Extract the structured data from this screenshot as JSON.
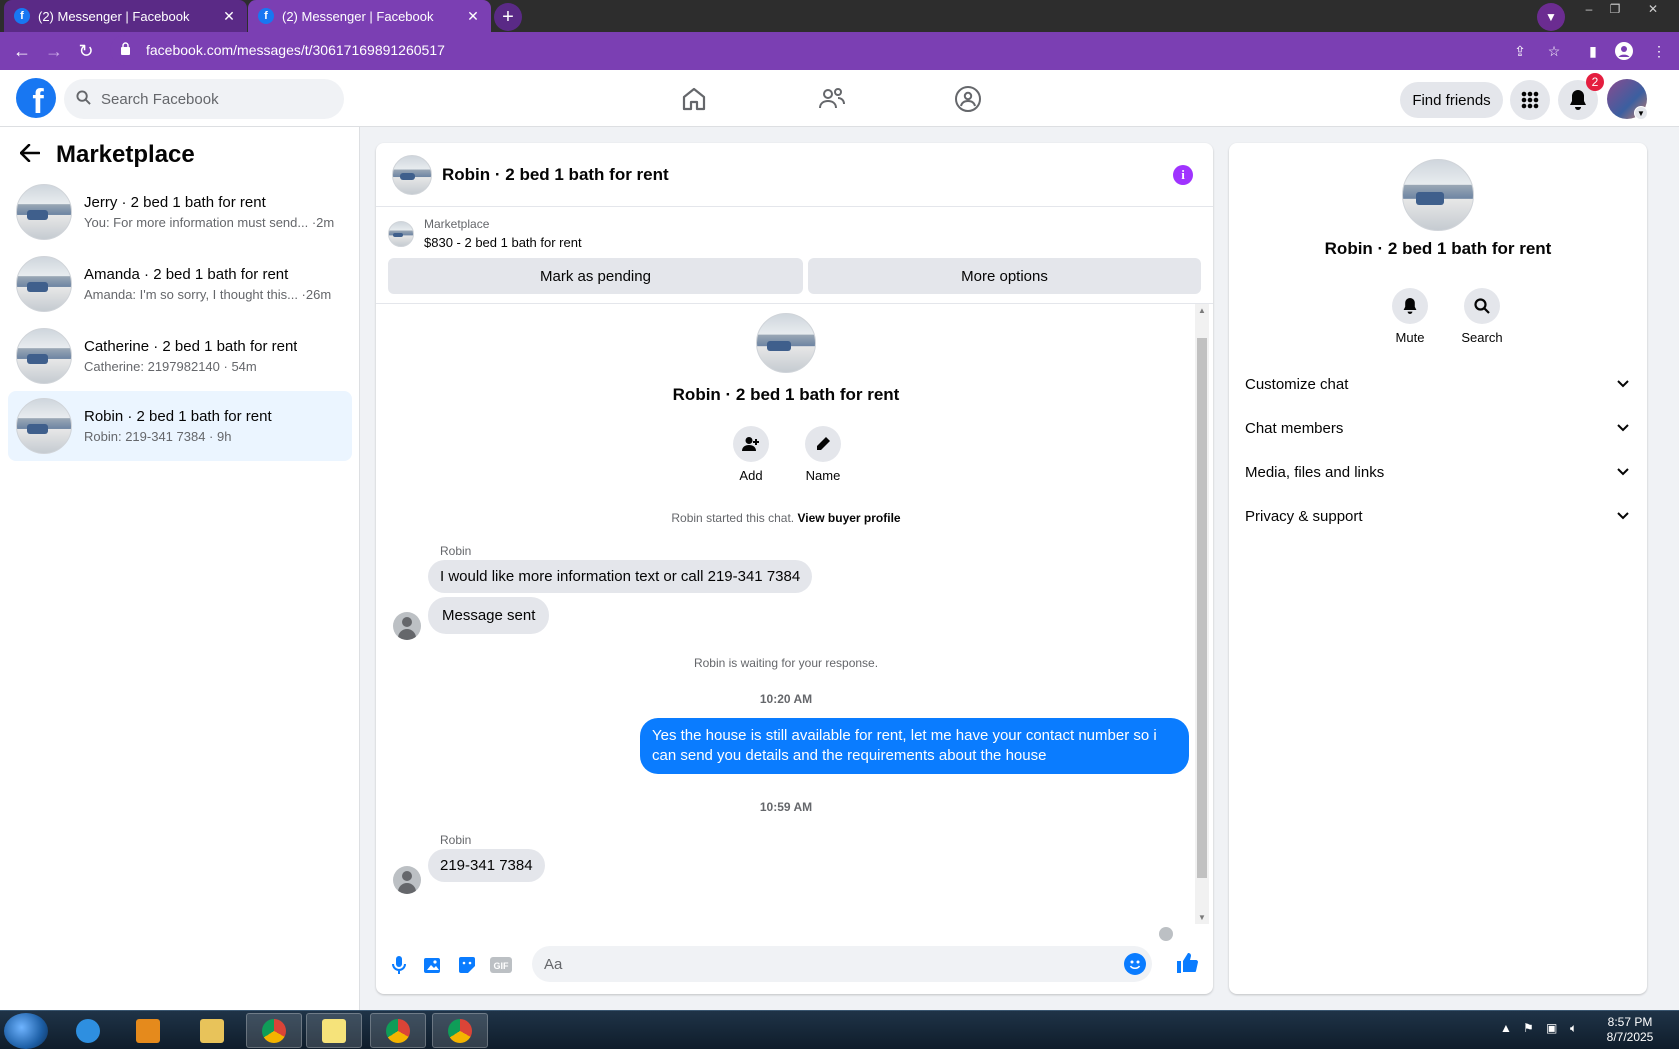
{
  "browser": {
    "tabs": [
      {
        "title": "(2) Messenger | Facebook",
        "active": false
      },
      {
        "title": "(2) Messenger | Facebook",
        "active": true
      }
    ],
    "url": "facebook.com/messages/t/30617169891260517"
  },
  "header": {
    "search_placeholder": "Search Facebook",
    "find_friends_label": "Find friends",
    "notification_count": "2",
    "brand_color": "#1877f2"
  },
  "sidebar": {
    "title": "Marketplace",
    "conversations": [
      {
        "name": "Jerry · 2 bed 1 bath for rent",
        "preview": "You: For more information must send... ·2m",
        "active": false
      },
      {
        "name": "Amanda · 2 bed 1 bath for rent",
        "preview": "Amanda: I'm so sorry, I thought this... ·26m",
        "active": false
      },
      {
        "name": "Catherine · 2 bed 1 bath for rent",
        "preview": "Catherine: 2197982140 · 54m",
        "active": false
      },
      {
        "name": "Robin · 2 bed 1 bath for rent",
        "preview": "Robin: 219-341 7384 · 9h",
        "active": true
      }
    ]
  },
  "chat": {
    "title": "Robin · 2 bed 1 bath for rent",
    "marketplace_label": "Marketplace",
    "listing": "$830 - 2 bed 1 bath for rent",
    "mark_pending_label": "Mark as pending",
    "more_options_label": "More options",
    "profile_name": "Robin · 2 bed 1 bath for rent",
    "add_label": "Add",
    "name_label": "Name",
    "started_text": "Robin started this chat.",
    "view_profile_link": "View buyer profile",
    "messages": [
      {
        "sender": "Robin",
        "text": "I would like more information text or call 219-341 7384"
      },
      {
        "text": "Message sent"
      }
    ],
    "waiting_text": "Robin is waiting for your response.",
    "time1": "10:20 AM",
    "outgoing": "Yes the house is still available for rent, let me have your contact number so i can send you details and the requirements about the house",
    "time2": "10:59 AM",
    "reply_sender": "Robin",
    "reply_text": "219-341 7384",
    "composer_placeholder": "Aa",
    "accent_color": "#0a7cff"
  },
  "details": {
    "name": "Robin · 2 bed 1 bath for rent",
    "mute_label": "Mute",
    "search_label": "Search",
    "sections": [
      "Customize chat",
      "Chat members",
      "Media, files and links",
      "Privacy & support"
    ]
  },
  "taskbar": {
    "time": "8:57 PM",
    "date": "8/7/2025"
  }
}
